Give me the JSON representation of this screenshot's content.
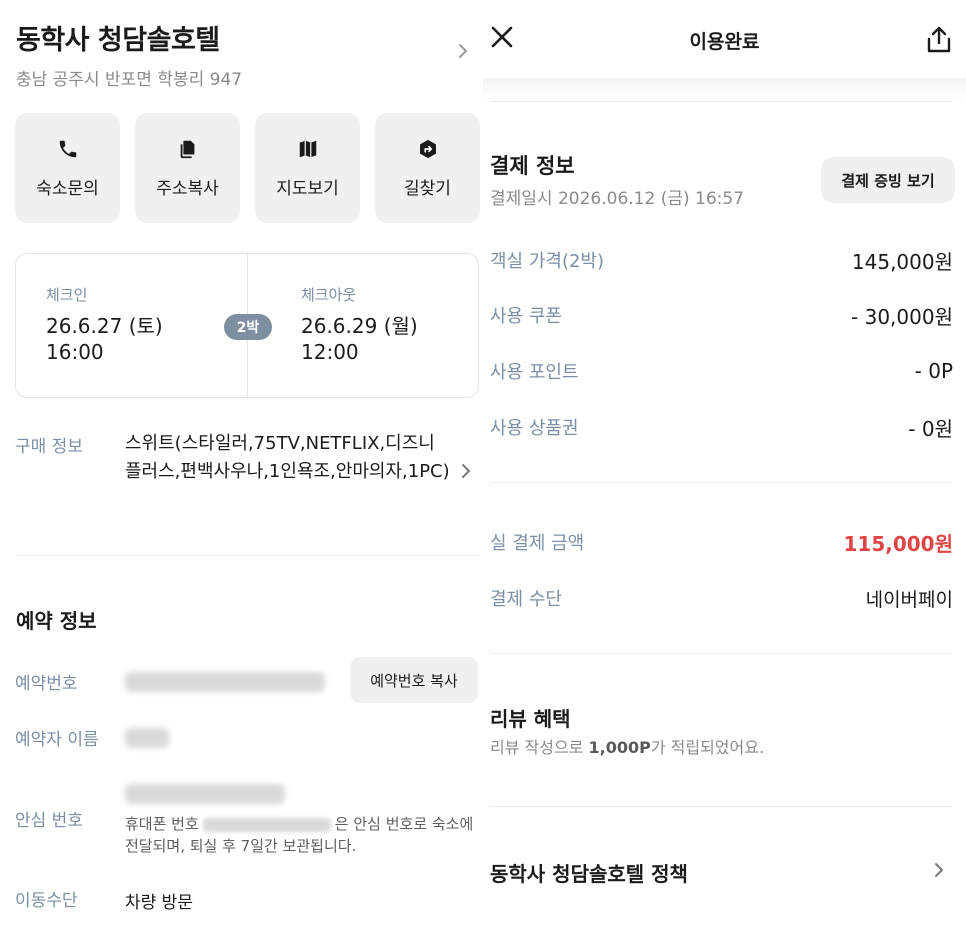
{
  "hotel": {
    "name": "동학사 청담솔호텔",
    "address": "충남 공주시 반포면 학봉리 947"
  },
  "actions": [
    {
      "label": "숙소문의",
      "icon": "phone-icon"
    },
    {
      "label": "주소복사",
      "icon": "copy-icon"
    },
    {
      "label": "지도보기",
      "icon": "map-icon"
    },
    {
      "label": "길찾기",
      "icon": "directions-icon"
    }
  ],
  "stay": {
    "checkin_label": "체크인",
    "checkin_date": "26.6.27 (토)",
    "checkin_time": "16:00",
    "nights": "2박",
    "checkout_label": "체크아웃",
    "checkout_date": "26.6.29 (월)",
    "checkout_time": "12:00"
  },
  "purchase": {
    "label": "구매 정보",
    "value": "스위트(스타일러,75TV,NETFLIX,디즈니플러스,편백사우나,1인욕조,안마의자,1PC)"
  },
  "reservation": {
    "title": "예약 정보",
    "number_label": "예약번호",
    "copy_button": "예약번호 복사",
    "name_label": "예약자 이름",
    "safe_label": "안심 번호",
    "safe_desc_prefix": "휴대폰 번호",
    "safe_desc_suffix": "은 안심 번호로 숙소에 전달되며, 퇴실 후 7일간 보관됩니다.",
    "transport_label": "이동수단",
    "transport_value": "차량 방문"
  },
  "topbar": {
    "title": "이용완료"
  },
  "payment": {
    "title": "결제 정보",
    "date": "결제일시 2026.06.12 (금) 16:57",
    "proof_button": "결제 증빙 보기",
    "rows": [
      {
        "label": "객실 가격(2박)",
        "amount": "145,000원"
      },
      {
        "label": "사용 쿠폰",
        "amount": "- 30,000원"
      },
      {
        "label": "사용 포인트",
        "amount": "- 0P"
      },
      {
        "label": "사용 상품권",
        "amount": "- 0원"
      }
    ],
    "total_label": "실 결제 금액",
    "total_amount": "115,000원",
    "method_label": "결제 수단",
    "method_value": "네이버페이",
    "total_color": "#e04545"
  },
  "review": {
    "title": "리뷰 혜택",
    "desc_prefix": "리뷰 작성으로 ",
    "desc_points": "1,000P",
    "desc_suffix": "가 적립되었어요."
  },
  "policy": {
    "title": "동학사 청담솔호텔 정책"
  },
  "colors": {
    "accent_label": "#7a8fa6",
    "badge": "#7e8fa1",
    "button_bg": "#f0f0f0"
  }
}
